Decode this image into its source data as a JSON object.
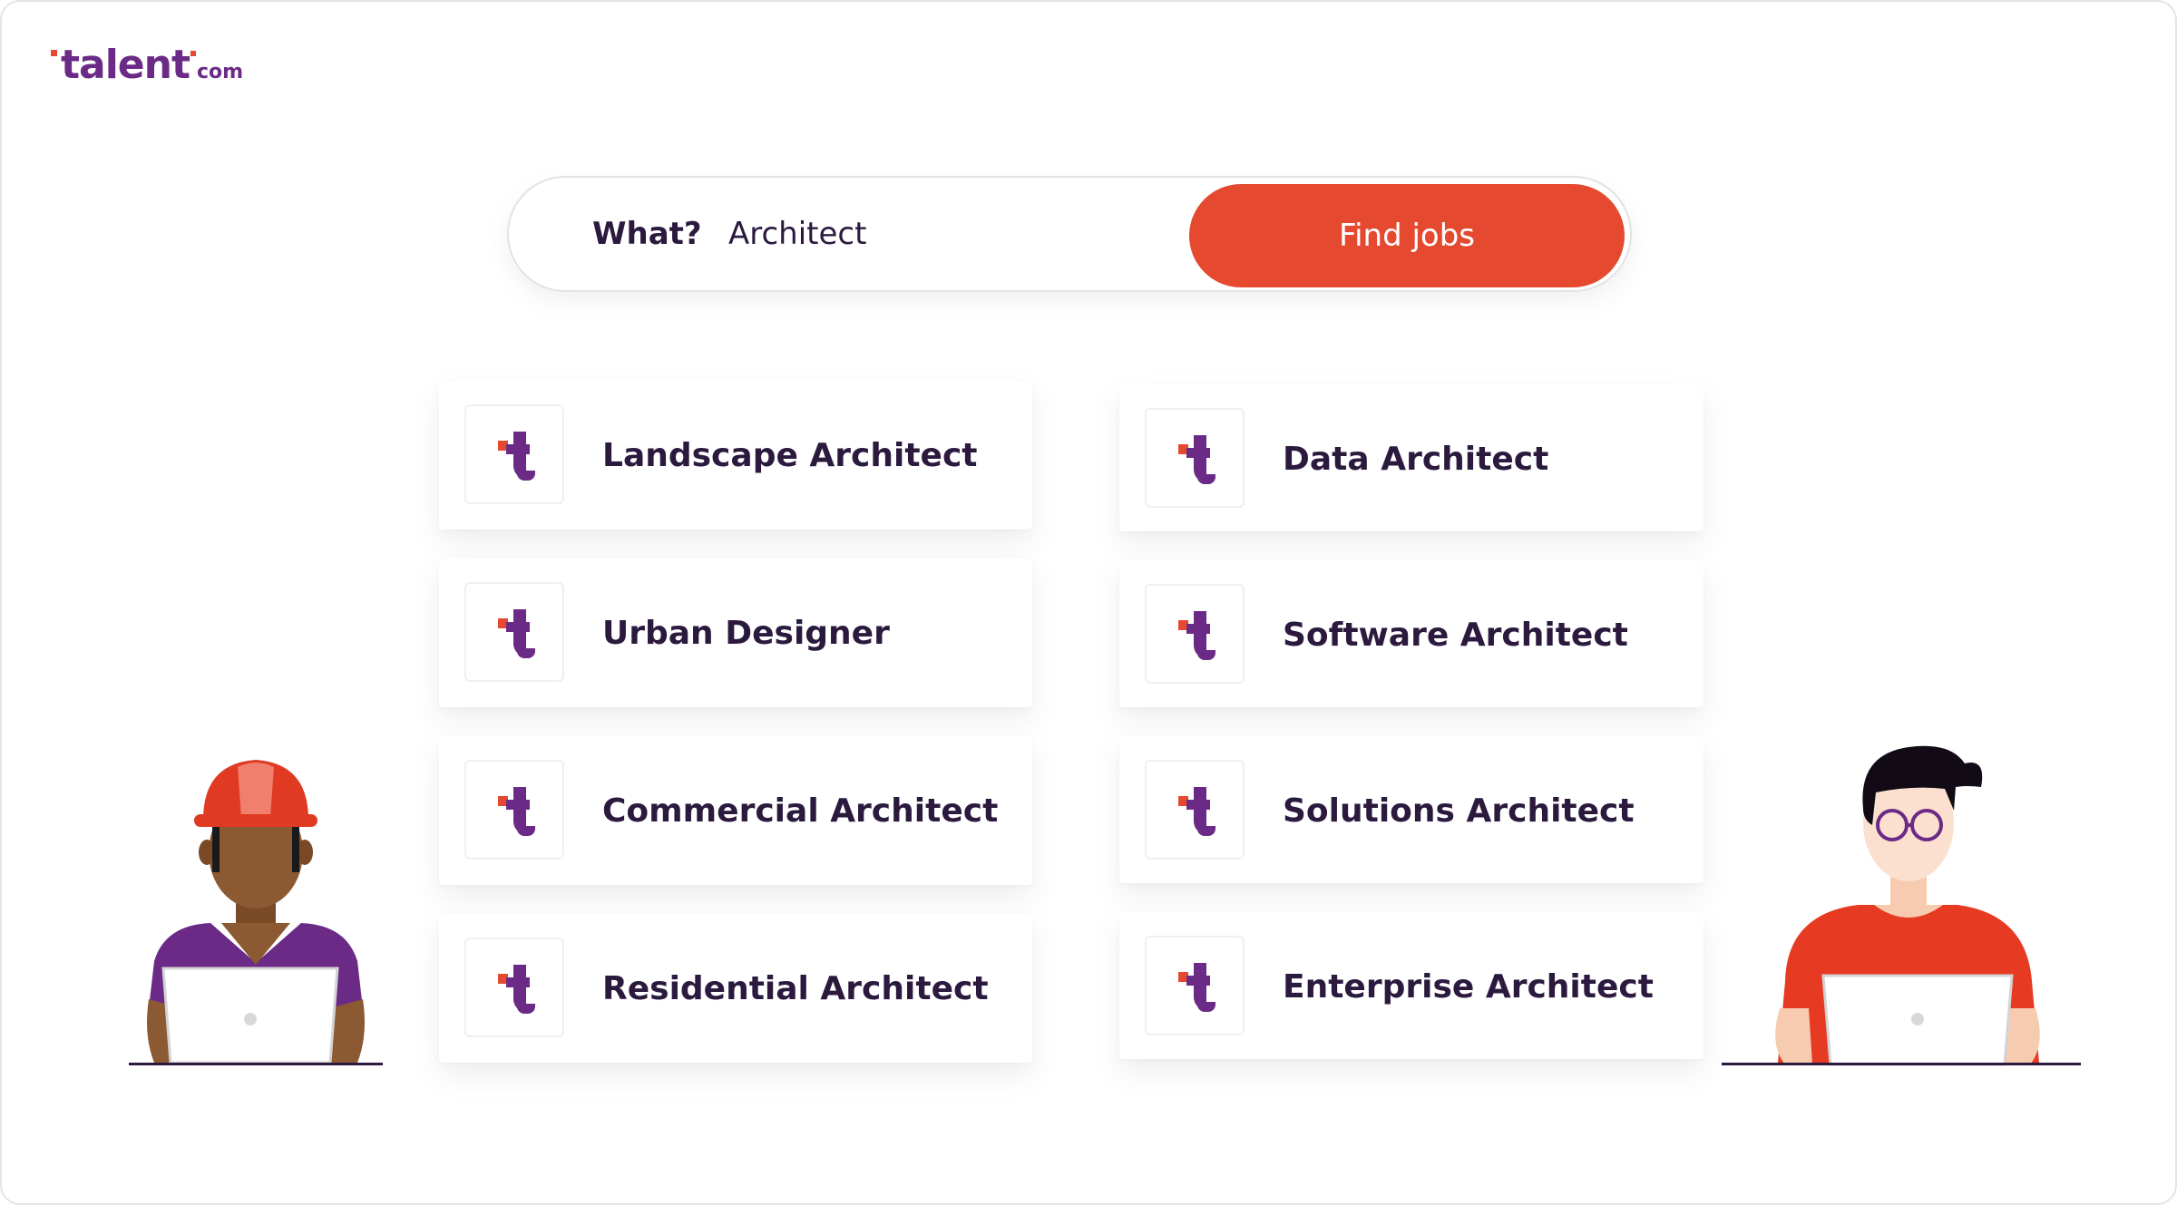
{
  "brand": {
    "name": "talent",
    "tld": "com"
  },
  "search": {
    "label": "What?",
    "value": "Architect",
    "button": "Find jobs"
  },
  "results": {
    "left": [
      {
        "title": "Landscape Architect"
      },
      {
        "title": "Urban Designer"
      },
      {
        "title": "Commercial Architect"
      },
      {
        "title": "Residential Architect"
      }
    ],
    "right": [
      {
        "title": "Data Architect"
      },
      {
        "title": "Software Architect"
      },
      {
        "title": "Solutions Architect"
      },
      {
        "title": "Enterprise Architect"
      }
    ]
  },
  "colors": {
    "accent": "#e54a30",
    "brand_purple": "#6b2a86",
    "text_dark": "#2b1a3e"
  },
  "icons": {
    "card_icon": "talent-t-logo-icon",
    "illustration_left": "construction-worker-with-laptop",
    "illustration_right": "developer-with-glasses-and-laptop"
  }
}
